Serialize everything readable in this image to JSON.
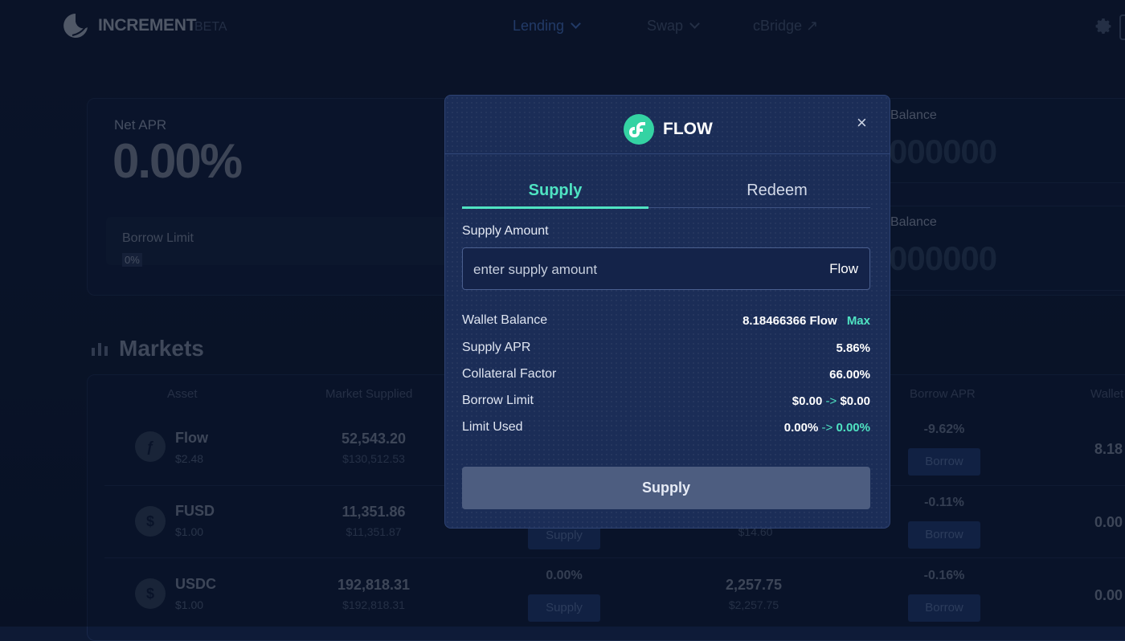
{
  "header": {
    "brand": "INCREMENT",
    "beta": "BETA",
    "nav": [
      {
        "label": "Lending",
        "active": true
      },
      {
        "label": "Swap",
        "active": false
      },
      {
        "label": "cBridge ↗",
        "active": false
      }
    ]
  },
  "stats": {
    "net_apr_label": "Net APR",
    "net_apr_value": "0.00%",
    "borrow_limit_label": "Borrow Limit",
    "borrow_limit_pct": "0%",
    "balance_1_label": "Balance",
    "balance_1_value": "000000",
    "balance_2_label": "Balance",
    "balance_2_value": "000000"
  },
  "markets": {
    "title": "Markets",
    "columns": [
      "Asset",
      "Market Supplied",
      "Borrow APR",
      "Wallet"
    ],
    "rows": [
      {
        "name": "Flow",
        "price": "$2.48",
        "supplied": "52,543.20",
        "supplied_usd": "$130,512.53",
        "borrow_apr": "-9.62%",
        "wallet": "8.18"
      },
      {
        "name": "FUSD",
        "price": "$1.00",
        "supplied": "11,351.86",
        "supplied_usd": "$11,351.87",
        "supply_btn": "Supply",
        "borrowed_usd": "$14.60",
        "borrow_apr": "-0.11%",
        "wallet": "0.00"
      },
      {
        "name": "USDC",
        "price": "$1.00",
        "supplied": "192,818.31",
        "supplied_usd": "$192,818.31",
        "supply_apr": "0.00%",
        "supply_btn": "Supply",
        "borrowed": "2,257.75",
        "borrowed_usd": "$2,257.75",
        "borrow_apr": "-0.16%",
        "wallet": "0.00"
      }
    ],
    "borrow_btn": "Borrow"
  },
  "modal": {
    "title": "FLOW",
    "close": "×",
    "tabs": {
      "supply": "Supply",
      "redeem": "Redeem"
    },
    "field_label": "Supply Amount",
    "input_placeholder": "enter supply amount",
    "input_unit": "Flow",
    "wallet_balance_label": "Wallet Balance",
    "wallet_balance_value": "8.18466366 Flow",
    "max_label": "Max",
    "supply_apr_label": "Supply APR",
    "supply_apr_value": "5.86%",
    "collateral_label": "Collateral Factor",
    "collateral_value": "66.00%",
    "borrow_limit_label": "Borrow Limit",
    "borrow_limit_from": "$0.00",
    "borrow_limit_to": "$0.00",
    "limit_used_label": "Limit Used",
    "limit_used_from": "0.00%",
    "limit_used_to": "0.00%",
    "arrow": "->",
    "submit_label": "Supply"
  },
  "colors": {
    "accent": "#4fe3c2",
    "background": "#0e1a35",
    "modal": "#1b2d57"
  }
}
